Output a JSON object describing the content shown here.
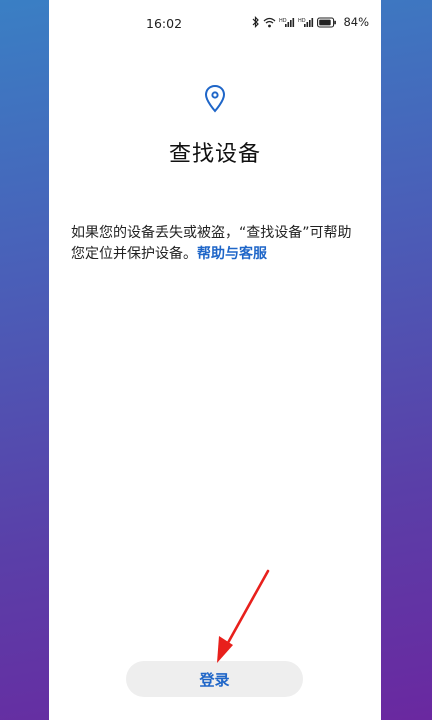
{
  "status_bar": {
    "time": "16:02",
    "battery_percent": "84%",
    "icons": [
      "bluetooth-icon",
      "wifi-icon",
      "signal-icon",
      "signal-icon",
      "battery-icon"
    ]
  },
  "page": {
    "icon": "location-pin-icon",
    "title": "查找设备",
    "description": "如果您的设备丢失或被盗，“查找设备”可帮助您定位并保护设备。",
    "help_link": "帮助与客服"
  },
  "actions": {
    "login_label": "登录"
  },
  "colors": {
    "accent": "#1f66c8",
    "annotation_arrow": "#e8201c"
  }
}
